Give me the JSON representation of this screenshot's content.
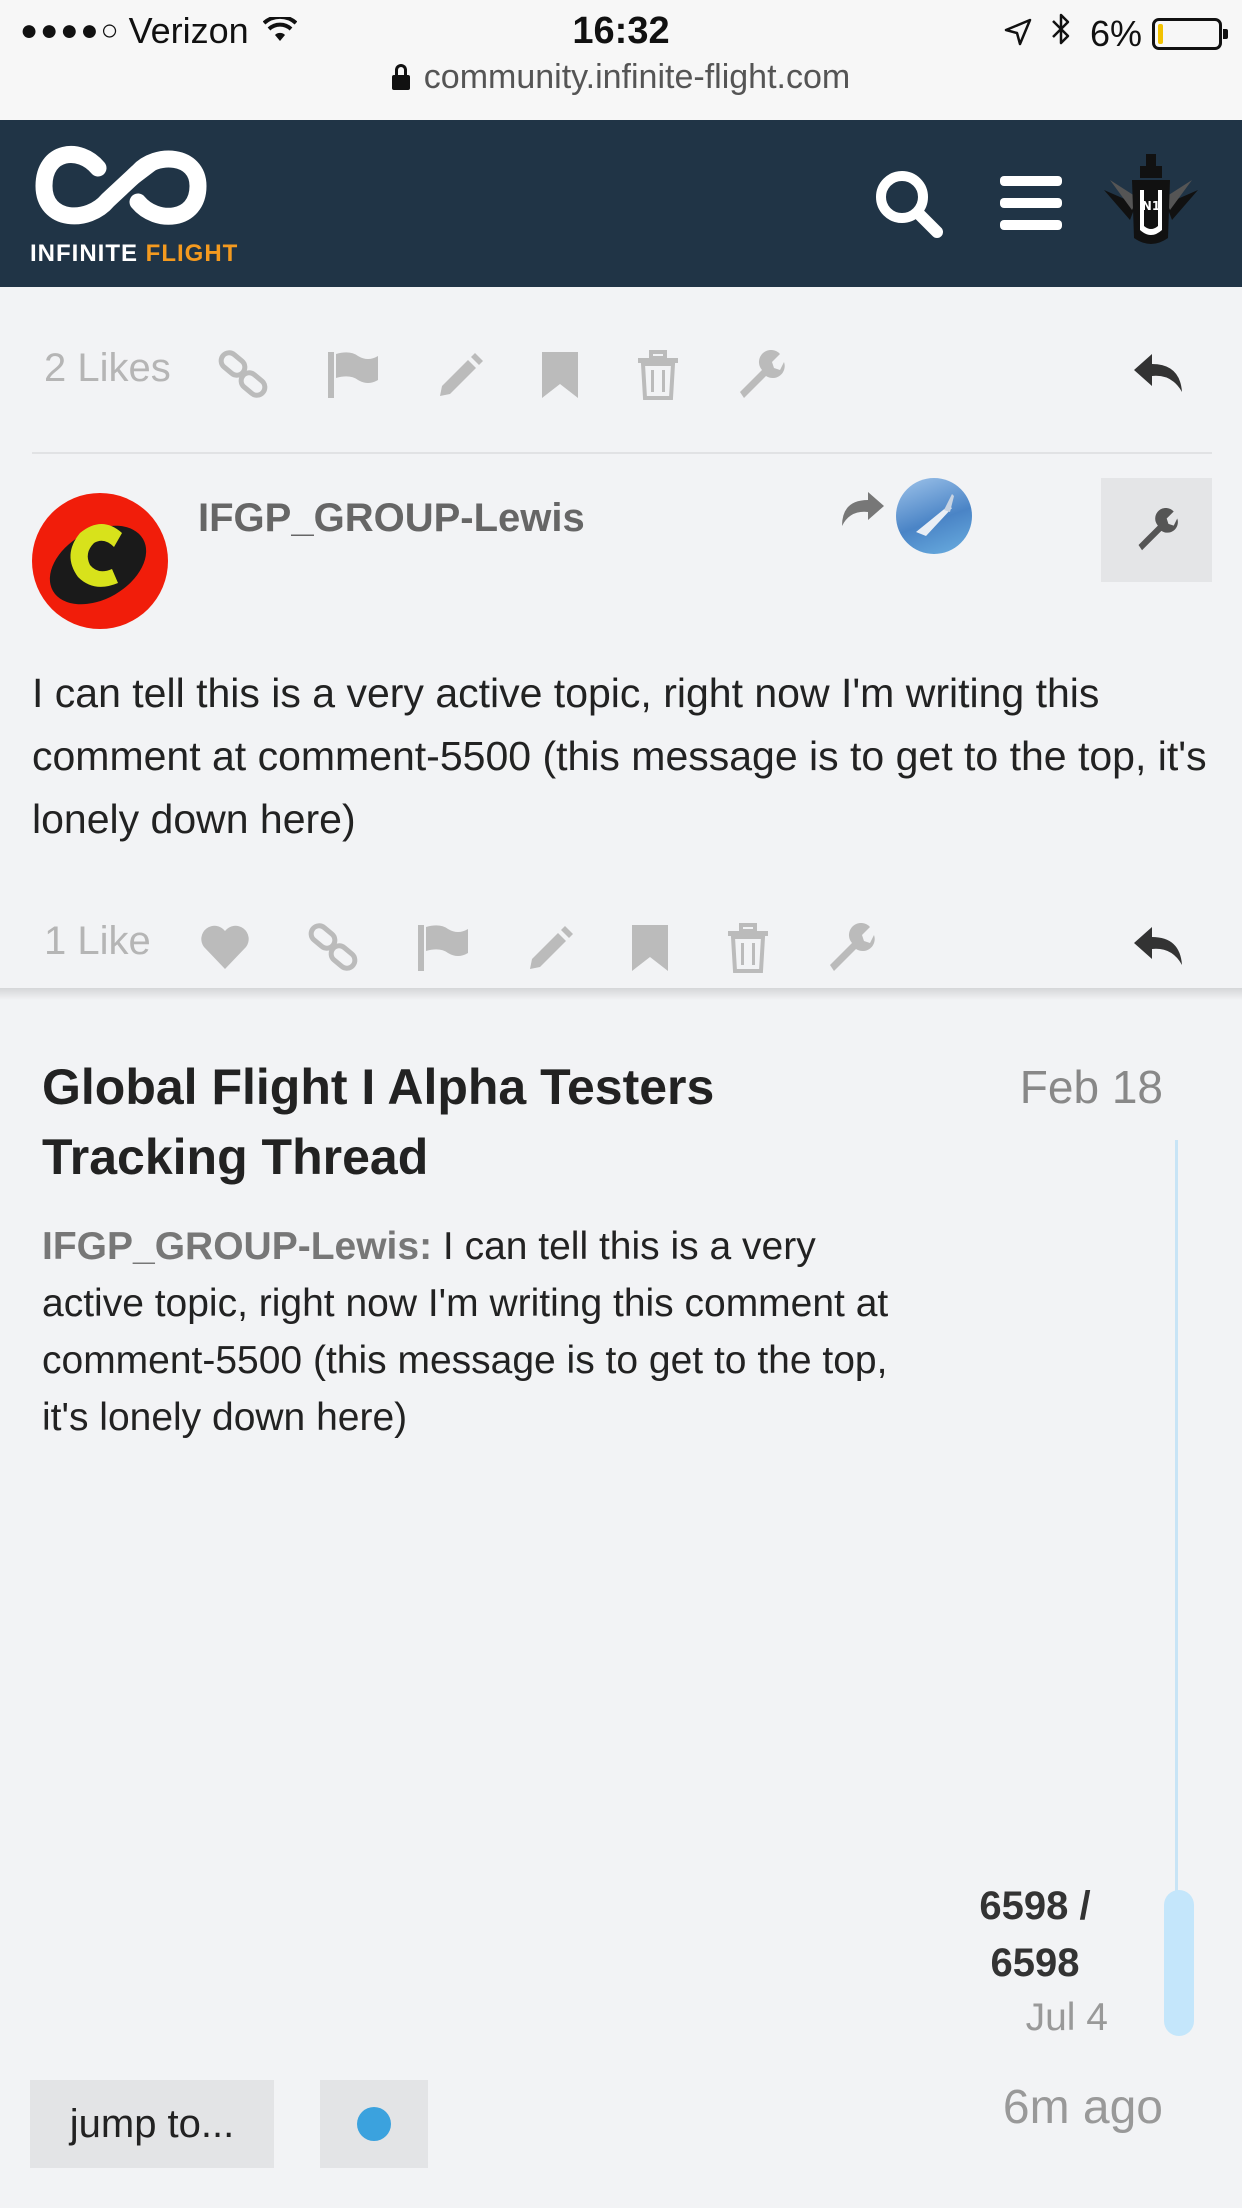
{
  "status_bar": {
    "carrier": "Verizon",
    "signal_dots": "●●●●○",
    "time": "16:32",
    "battery": "6%",
    "battery_level": 0.06
  },
  "browser": {
    "url": "community.infinite-flight.com"
  },
  "header": {
    "logo_text_white": "INFINITE",
    "logo_text_orange": "FLIGHT",
    "colors": {
      "background": "#203446",
      "accent": "#f49a1f"
    }
  },
  "post_previous": {
    "like_count": "2 Likes",
    "actions": [
      "link-icon",
      "flag-icon",
      "edit-icon",
      "bookmark-icon",
      "delete-icon",
      "wrench-icon",
      "reply-icon"
    ]
  },
  "post": {
    "username": "IFGP_GROUP-Lewis",
    "avatar_letter": "C",
    "body": "I can tell this is a very active topic, right now I'm writing this comment at comment-5500 (this message is to get to the top, it's lonely down here)",
    "like_count": "1 Like",
    "actions": [
      "heart-icon",
      "link-icon",
      "flag-icon",
      "edit-icon",
      "bookmark-icon",
      "delete-icon",
      "wrench-icon",
      "reply-icon"
    ]
  },
  "topic": {
    "title": "Global Flight I Alpha Testers Tracking Thread",
    "date": "Feb 18",
    "excerpt_user": "IFGP_GROUP-Lewis:",
    "excerpt_text": " I can tell this is a very active topic, right now I'm writing this comment at comment-5500 (this message is to get to the top, it's lonely down here)"
  },
  "timeline": {
    "counter_line1": "6598 /",
    "counter_line2": "6598",
    "last_date": "Jul 4",
    "ago": "6m ago",
    "progress": 1.0
  },
  "footer": {
    "jump_label": "jump to...",
    "accent_dot": "#3ba2de"
  }
}
